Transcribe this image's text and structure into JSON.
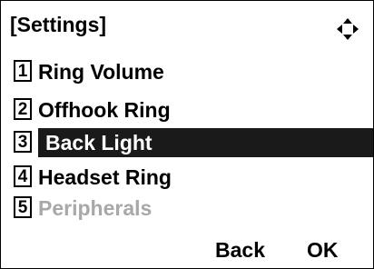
{
  "header": {
    "title": "[Settings]",
    "nav_icon": "four-way-navigation-icon"
  },
  "menu": {
    "selected_index": 2,
    "items": [
      {
        "number": "1",
        "label": "Ring Volume",
        "enabled": true
      },
      {
        "number": "2",
        "label": "Offhook Ring",
        "enabled": true
      },
      {
        "number": "3",
        "label": "Back Light",
        "enabled": true
      },
      {
        "number": "4",
        "label": "Headset Ring",
        "enabled": true
      },
      {
        "number": "5",
        "label": "Peripherals",
        "enabled": false
      }
    ]
  },
  "softkeys": {
    "back_label": "Back",
    "ok_label": "OK"
  },
  "colors": {
    "highlight": "#1a1a1a",
    "disabled_text": "#a8a8a8"
  }
}
